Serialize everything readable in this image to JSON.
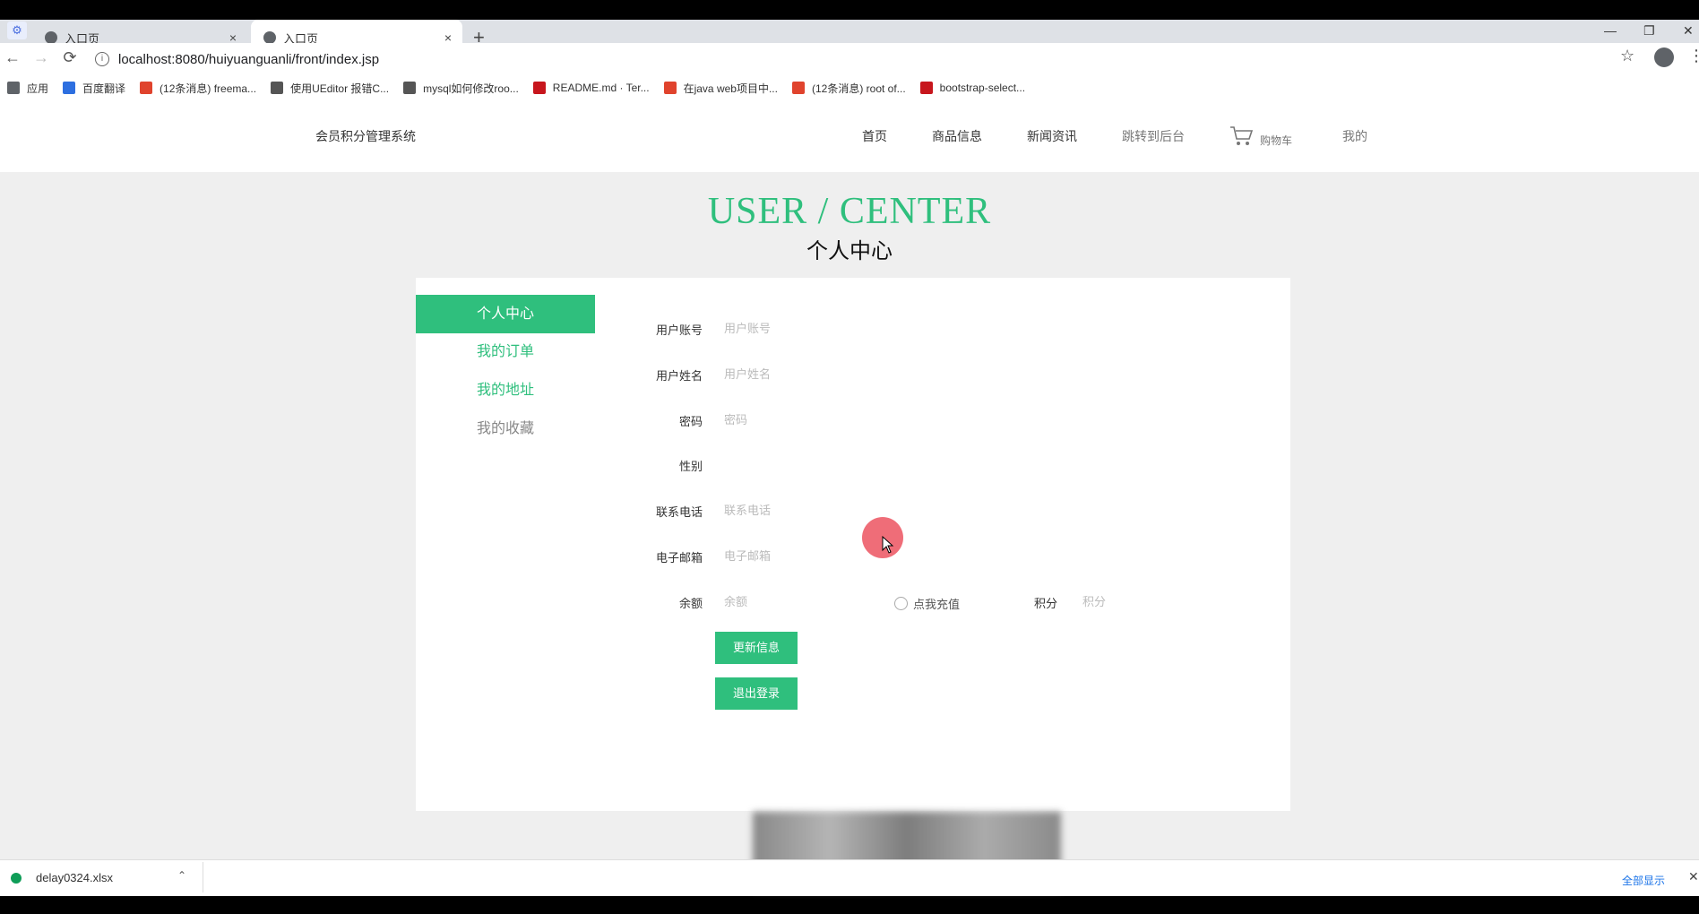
{
  "browser": {
    "tabs": [
      {
        "title": "入口页",
        "close": "×"
      },
      {
        "title": "入口页",
        "close": "×"
      }
    ],
    "new_tab": "+",
    "window_controls": {
      "minimize": "—",
      "restore": "❐",
      "close": "✕"
    },
    "nav": {
      "back": "←",
      "forward": "→",
      "reload": "⟳"
    },
    "url": "localhost:8080/huiyuanguanli/front/index.jsp",
    "info_glyph": "i",
    "star": "☆",
    "menu": "⋮",
    "bookmarks": [
      {
        "label": "应用",
        "color": "#5f6368"
      },
      {
        "label": "百度翻译",
        "color": "#2d6fe0"
      },
      {
        "label": "(12条消息) freema...",
        "color": "#e0432d"
      },
      {
        "label": "使用UEditor 报错C...",
        "color": "#555555"
      },
      {
        "label": "mysql如何修改roo...",
        "color": "#555555"
      },
      {
        "label": "README.md · Ter...",
        "color": "#c7161d"
      },
      {
        "label": "在java web项目中...",
        "color": "#e0432d"
      },
      {
        "label": "(12条消息) root of...",
        "color": "#e0432d"
      },
      {
        "label": "bootstrap-select...",
        "color": "#c7161d"
      }
    ]
  },
  "site": {
    "brand": "会员积分管理系统",
    "nav": [
      "首页",
      "商品信息",
      "新闻资讯",
      "跳转到后台",
      "购物车",
      "我的"
    ]
  },
  "hero": {
    "en": "USER / CENTER",
    "zh": "个人中心"
  },
  "sidebar": {
    "items": [
      {
        "label": "个人中心"
      },
      {
        "label": "我的订单"
      },
      {
        "label": "我的地址"
      },
      {
        "label": "我的收藏"
      }
    ]
  },
  "form": {
    "username": {
      "label": "用户账号",
      "placeholder": "用户账号"
    },
    "name": {
      "label": "用户姓名",
      "placeholder": "用户姓名"
    },
    "password": {
      "label": "密码",
      "placeholder": "密码"
    },
    "gender": {
      "label": "性别"
    },
    "phone": {
      "label": "联系电话",
      "placeholder": "联系电话"
    },
    "email": {
      "label": "电子邮箱",
      "placeholder": "电子邮箱"
    },
    "balance": {
      "label": "余额",
      "placeholder": "余额"
    },
    "recharge": {
      "label": "点我充值"
    },
    "points": {
      "label": "积分",
      "placeholder": "积分"
    }
  },
  "buttons": {
    "update": "更新信息",
    "logout": "退出登录"
  },
  "downloads": {
    "file": "delay0324.xlsx",
    "chevron": "⌃",
    "show_all": "全部显示",
    "close": "✕"
  },
  "colors": {
    "accent": "#2fbf7d",
    "cursor_highlight": "#ec5460"
  }
}
